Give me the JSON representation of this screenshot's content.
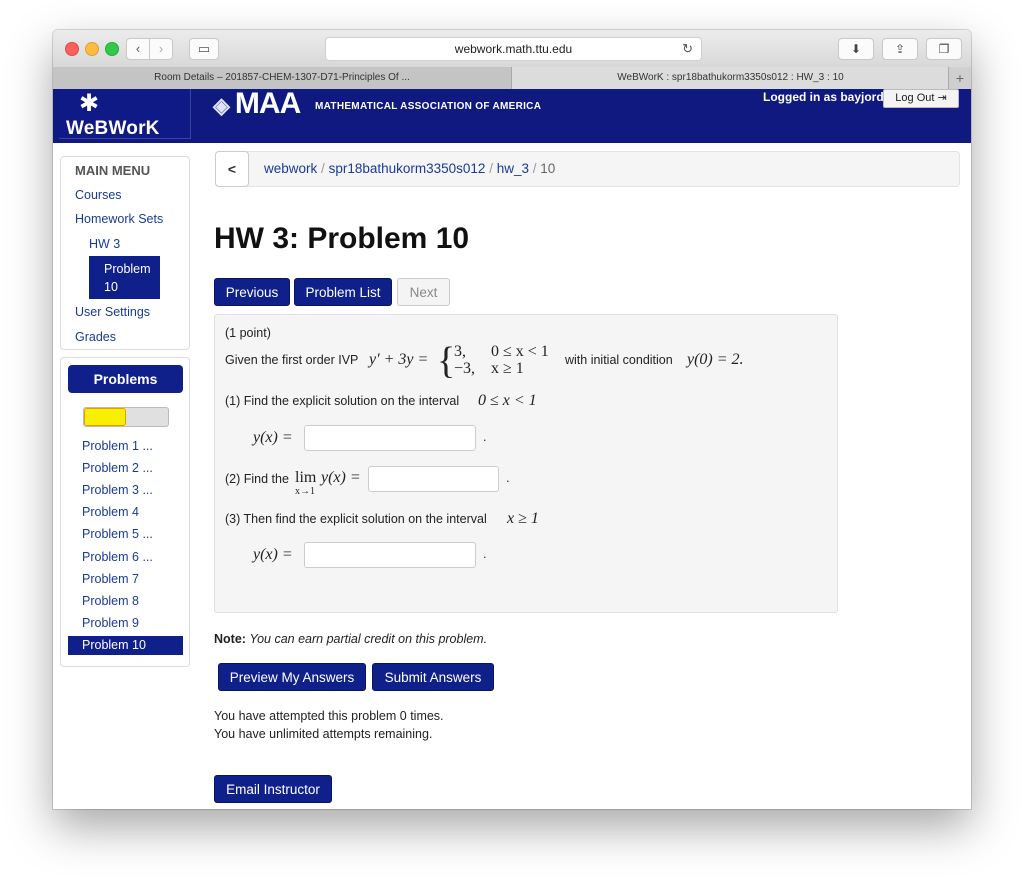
{
  "browser": {
    "url": "webwork.math.ttu.edu",
    "tabs": [
      {
        "label": "Room Details – 201857-CHEM-1307-D71-Principles Of ..."
      },
      {
        "label": "WeBWorK : spr18bathukorm3350s012 : HW_3 : 10"
      }
    ]
  },
  "header": {
    "logo_text": "WeBWorK",
    "maa_text": "MAA",
    "maa_subtitle": "MATHEMATICAL ASSOCIATION OF AMERICA",
    "logged_in": "Logged in as bayjorda.",
    "logout_label": "Log Out"
  },
  "menu": {
    "title": "MAIN MENU",
    "items": [
      "Courses",
      "Homework Sets",
      "HW 3",
      "Problem 10",
      "User Settings",
      "Grades"
    ]
  },
  "problems_panel": {
    "title": "Problems",
    "progress_fraction": 0.5,
    "items": [
      "Problem 1 ...",
      "Problem 2 ...",
      "Problem 3 ...",
      "Problem 4",
      "Problem 5 ...",
      "Problem 6 ...",
      "Problem 7",
      "Problem 8",
      "Problem 9",
      "Problem 10"
    ]
  },
  "breadcrumb": {
    "back": "<",
    "parts": [
      "webwork",
      "spr18bathukorm3350s012",
      "hw_3",
      "10"
    ]
  },
  "page_title": "HW 3: Problem 10",
  "nav": {
    "previous": "Previous",
    "problem_list": "Problem List",
    "next": "Next"
  },
  "problem": {
    "points": "(1 point)",
    "given_prefix": "Given the first order IVP",
    "ivp_lhs": "y′ + 3y =",
    "case1_value": "3,",
    "case1_cond": "0 ≤ x < 1",
    "case2_value": "−3,",
    "case2_cond": "x ≥ 1",
    "with_initial": "with initial condition",
    "initial": "y(0) = 2.",
    "part1": "(1) Find the explicit solution on the interval",
    "part1_interval": "0 ≤ x < 1",
    "part1_label": "y(x) =",
    "part2_prefix": "(2) Find the",
    "part2_lim": "lim",
    "part2_sub": "x→1",
    "part2_expr": "y(x) =",
    "part3": "(3) Then find the explicit solution on the interval",
    "part3_interval": "x ≥ 1",
    "part3_label": "y(x) =",
    "period": "."
  },
  "note": {
    "label": "Note:",
    "text": "You can earn partial credit on this problem."
  },
  "actions": {
    "preview": "Preview My Answers",
    "submit": "Submit Answers",
    "email": "Email Instructor"
  },
  "attempts": {
    "line1": "You have attempted this problem 0 times.",
    "line2": "You have unlimited attempts remaining."
  }
}
